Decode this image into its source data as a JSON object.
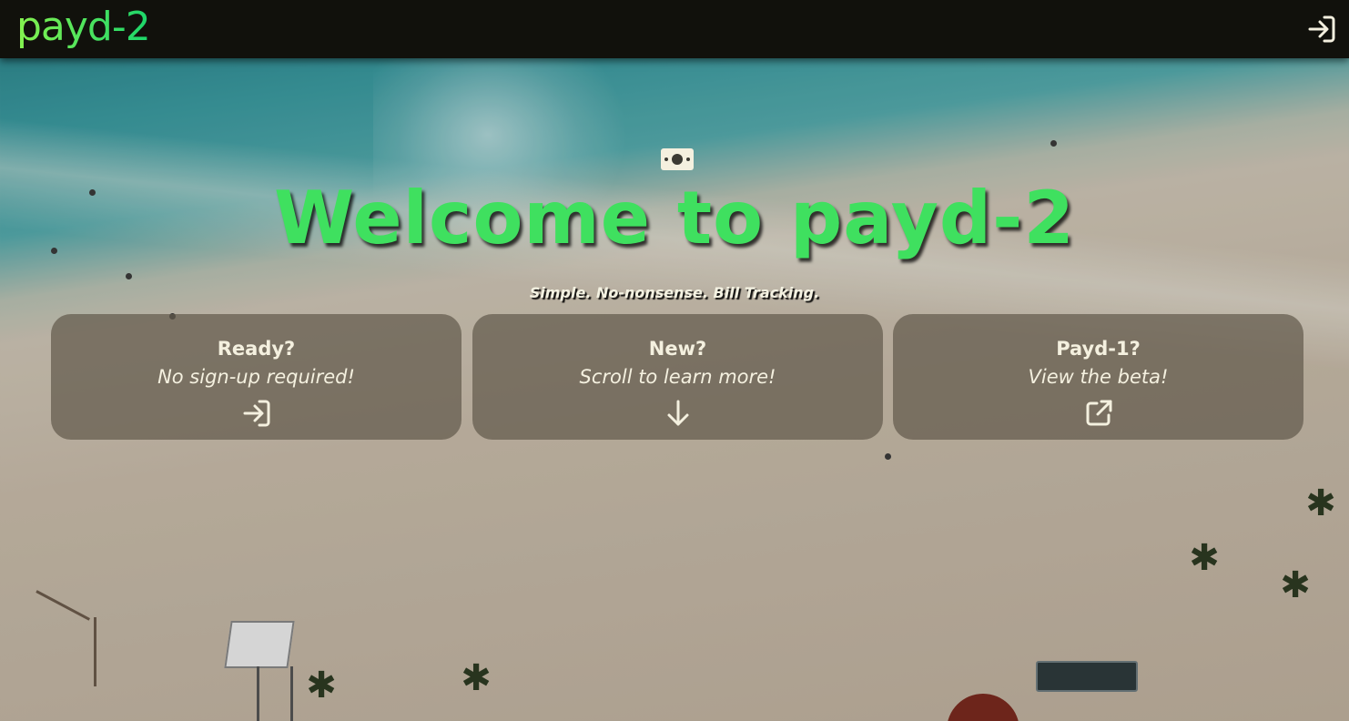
{
  "app": {
    "logo_text": "payd-2",
    "accent_colors": [
      "#86f24f",
      "#1bd66b"
    ],
    "header_background": "#11110c"
  },
  "header": {
    "login_icon": "sign-in-icon"
  },
  "hero": {
    "icon": "money-bill-icon",
    "title": "Welcome to payd-2",
    "subtitle": "Simple. No-nonsense. Bill Tracking."
  },
  "cards": [
    {
      "title": "Ready?",
      "description": "No sign-up required!",
      "icon": "sign-in-icon"
    },
    {
      "title": "New?",
      "description": "Scroll to learn more!",
      "icon": "arrow-down-icon"
    },
    {
      "title": "Payd-1?",
      "description": "View the beta!",
      "icon": "external-link-icon"
    }
  ]
}
